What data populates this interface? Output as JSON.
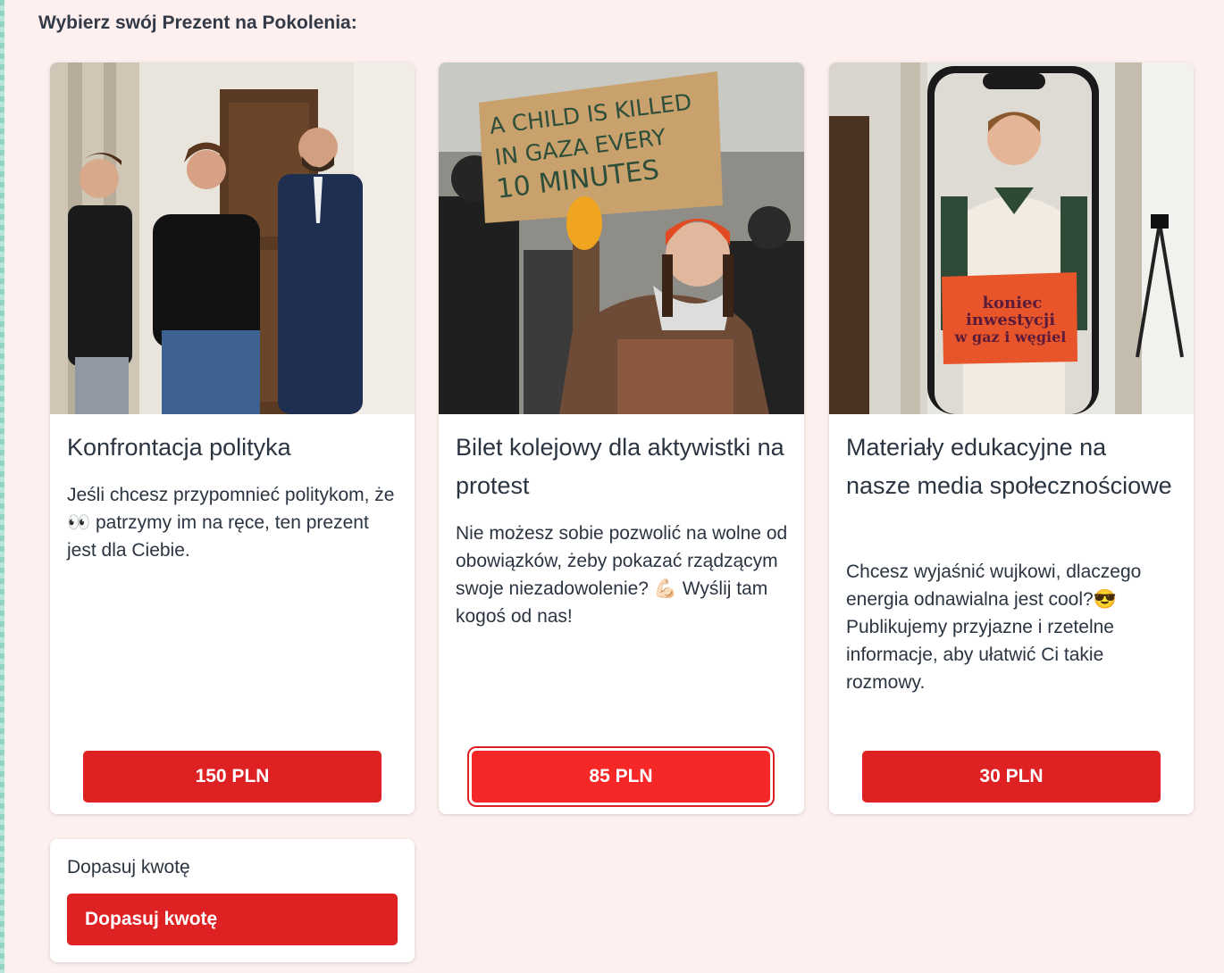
{
  "heading": "Wybierz swój Prezent na Pokolenia:",
  "colors": {
    "accent": "#de2224",
    "background": "#fdf0ef",
    "text": "#2b3441"
  },
  "cards": [
    {
      "title": "Konfrontacja polityka",
      "description": "Jeśli chcesz przypomnieć politykom, że 👀 patrzymy im na ręce, ten prezent jest dla Ciebie.",
      "price": "150 PLN",
      "selected": false
    },
    {
      "title": "Bilet kolejowy dla aktywistki na protest",
      "description": "Nie możesz sobie pozwolić na wolne od obowiązków, żeby pokazać rządzącym swoje niezadowolenie? 💪🏻 Wyślij tam kogoś od nas!",
      "price": "85 PLN",
      "selected": true,
      "sign_text": [
        "A CHILD IS KILLED",
        "IN GAZA  EVERY",
        "10 MINUTES"
      ]
    },
    {
      "title": "Materiały edukacyjne na nasze media społecznościowe",
      "description": "Chcesz wyjaśnić wujkowi, dlaczego energia odnawialna jest cool?😎 Publikujemy przyjazne i rzetelne informacje, aby ułatwić Ci takie rozmowy.",
      "price": "30 PLN",
      "selected": false,
      "sign_text": [
        "koniec",
        "inwestycji",
        "w gaz i węgiel"
      ]
    }
  ],
  "custom_amount": {
    "label": "Dopasuj kwotę",
    "button": "Dopasuj kwotę"
  }
}
